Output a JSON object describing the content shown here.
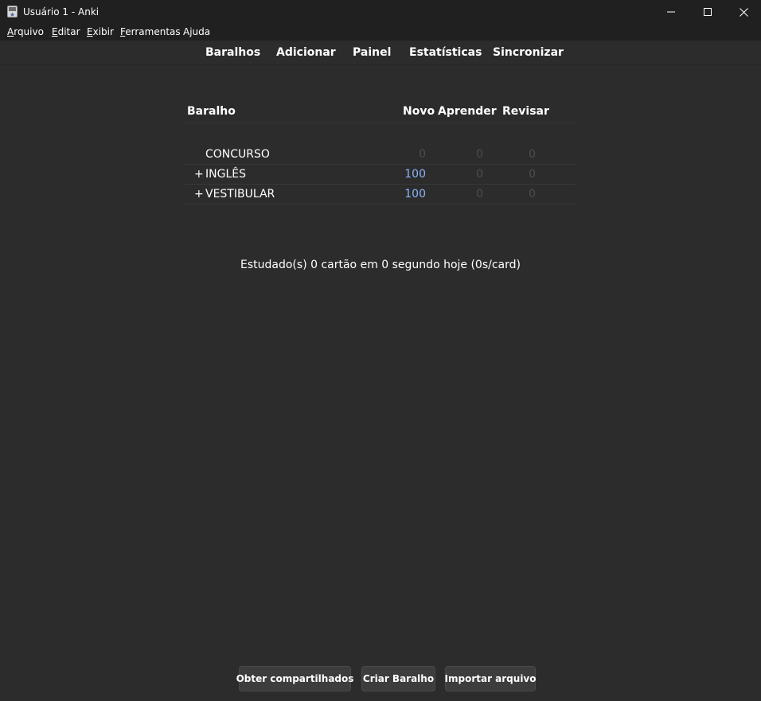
{
  "window": {
    "title": "Usuário 1 - Anki"
  },
  "menu": {
    "items": [
      {
        "accel": "A",
        "rest": "rquivo"
      },
      {
        "accel": "E",
        "rest": "ditar"
      },
      {
        "accel": "E",
        "rest": "xibir"
      },
      {
        "accel": "F",
        "rest": "erramentas"
      },
      {
        "accel": "",
        "rest": "Ajuda"
      }
    ]
  },
  "toolbar": {
    "links": [
      "Baralhos",
      "Adicionar",
      "Painel",
      "Estatísticas",
      "Sincronizar"
    ]
  },
  "deck_table": {
    "headers": {
      "deck": "Baralho",
      "new": "Novo",
      "learn": "Aprender",
      "review": "Revisar"
    },
    "rows": [
      {
        "expander": "",
        "name": "CONCURSO",
        "new": "0",
        "learn": "0",
        "review": "0"
      },
      {
        "expander": "+",
        "name": "INGLÊS",
        "new": "100",
        "learn": "0",
        "review": "0"
      },
      {
        "expander": "+",
        "name": "VESTIBULAR",
        "new": "100",
        "learn": "0",
        "review": "0"
      }
    ]
  },
  "stats": {
    "studied_text": "Estudado(s) 0 cartão em 0 segundo hoje (0s/card)"
  },
  "buttons": {
    "shared": "Obter compartilhados",
    "create": "Criar Baralho",
    "import": "Importar arquivo"
  },
  "colors": {
    "background": "#2c2c2c",
    "titlebar": "#202020",
    "new_count": "#8ab4f8",
    "zero_count": "#4d4d4d"
  },
  "icons": {
    "app": "anki-icon",
    "minimize": "minimize-icon",
    "maximize": "maximize-icon",
    "close": "close-icon"
  }
}
